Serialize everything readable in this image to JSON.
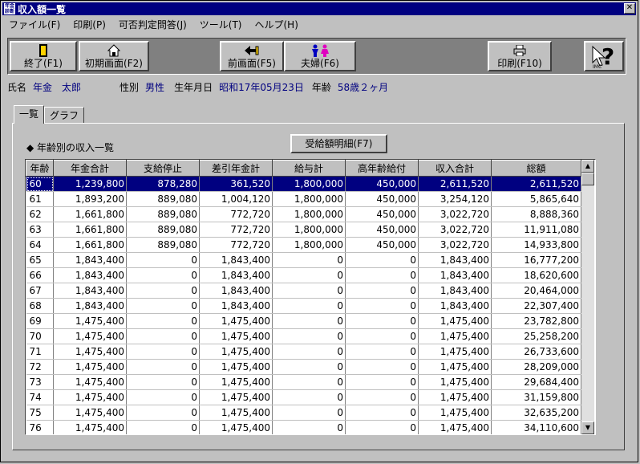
{
  "window": {
    "title": "収入額一覧",
    "app_icon_text": "年金診断"
  },
  "menu": [
    "ファイル(F)",
    "印刷(P)",
    "可否判定問答(J)",
    "ツール(T)",
    "ヘルプ(H)"
  ],
  "toolbar": {
    "exit": "終了(F1)",
    "initial": "初期画面(F2)",
    "prev": "前画面(F5)",
    "couple": "夫婦(F6)",
    "print": "印刷(F10)",
    "help_icon": "IMC"
  },
  "person": {
    "name_label": "氏名",
    "name": "年金　太郎",
    "sex_label": "性別",
    "sex": "男性",
    "birth_label": "生年月日",
    "birth": "昭和17年05月23日",
    "age_label": "年齢",
    "age": "58歳２ヶ月"
  },
  "tabs": [
    "一覧",
    "グラフ"
  ],
  "section_title": "◆ 年齢別の収入一覧",
  "detail_button": "受給額明細(F7)",
  "table": {
    "columns": [
      "年齢",
      "年金合計",
      "支給停止",
      "差引年金計",
      "給与計",
      "高年齢給付",
      "収入合計",
      "総額"
    ],
    "rows": [
      [
        "60",
        "1,239,800",
        "878,280",
        "361,520",
        "1,800,000",
        "450,000",
        "2,611,520",
        "2,611,520"
      ],
      [
        "61",
        "1,893,200",
        "889,080",
        "1,004,120",
        "1,800,000",
        "450,000",
        "3,254,120",
        "5,865,640"
      ],
      [
        "62",
        "1,661,800",
        "889,080",
        "772,720",
        "1,800,000",
        "450,000",
        "3,022,720",
        "8,888,360"
      ],
      [
        "63",
        "1,661,800",
        "889,080",
        "772,720",
        "1,800,000",
        "450,000",
        "3,022,720",
        "11,911,080"
      ],
      [
        "64",
        "1,661,800",
        "889,080",
        "772,720",
        "1,800,000",
        "450,000",
        "3,022,720",
        "14,933,800"
      ],
      [
        "65",
        "1,843,400",
        "0",
        "1,843,400",
        "0",
        "0",
        "1,843,400",
        "16,777,200"
      ],
      [
        "66",
        "1,843,400",
        "0",
        "1,843,400",
        "0",
        "0",
        "1,843,400",
        "18,620,600"
      ],
      [
        "67",
        "1,843,400",
        "0",
        "1,843,400",
        "0",
        "0",
        "1,843,400",
        "20,464,000"
      ],
      [
        "68",
        "1,843,400",
        "0",
        "1,843,400",
        "0",
        "0",
        "1,843,400",
        "22,307,400"
      ],
      [
        "69",
        "1,475,400",
        "0",
        "1,475,400",
        "0",
        "0",
        "1,475,400",
        "23,782,800"
      ],
      [
        "70",
        "1,475,400",
        "0",
        "1,475,400",
        "0",
        "0",
        "1,475,400",
        "25,258,200"
      ],
      [
        "71",
        "1,475,400",
        "0",
        "1,475,400",
        "0",
        "0",
        "1,475,400",
        "26,733,600"
      ],
      [
        "72",
        "1,475,400",
        "0",
        "1,475,400",
        "0",
        "0",
        "1,475,400",
        "28,209,000"
      ],
      [
        "73",
        "1,475,400",
        "0",
        "1,475,400",
        "0",
        "0",
        "1,475,400",
        "29,684,400"
      ],
      [
        "74",
        "1,475,400",
        "0",
        "1,475,400",
        "0",
        "0",
        "1,475,400",
        "31,159,800"
      ],
      [
        "75",
        "1,475,400",
        "0",
        "1,475,400",
        "0",
        "0",
        "1,475,400",
        "32,635,200"
      ],
      [
        "76",
        "1,475,400",
        "0",
        "1,475,400",
        "0",
        "0",
        "1,475,400",
        "34,110,600"
      ]
    ]
  },
  "colors": {
    "title_bar": "#000080",
    "selection": "#000080",
    "face": "#c0c0c0",
    "info_value": "#000080"
  }
}
